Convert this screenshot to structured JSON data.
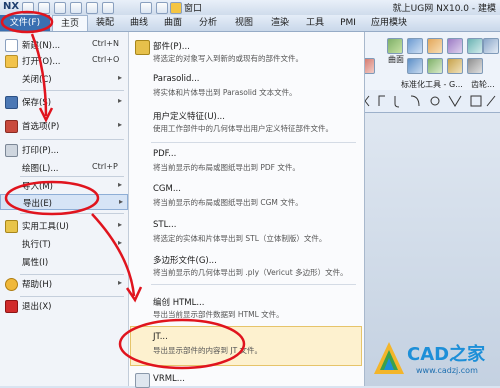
{
  "titlebar": {
    "logo": "NX",
    "window_menu": "窗口",
    "title": "就上UG网 NX10.0 - 建模"
  },
  "menubar": {
    "tabs": [
      "文件(F)",
      "主页",
      "装配",
      "曲线",
      "曲面",
      "分析",
      "视图",
      "渲染",
      "工具",
      "PMI",
      "应用模块"
    ]
  },
  "ribbon": {
    "surface_label": "曲面",
    "std_label": "标准化工具 - G...",
    "gear_label": "齿轮..."
  },
  "file_menu": {
    "items": [
      {
        "label": "新建(N)...",
        "shortcut": "Ctrl+N",
        "icon": "new-file-icon"
      },
      {
        "label": "打开(O)...",
        "shortcut": "Ctrl+O",
        "icon": "open-folder-icon"
      },
      {
        "label": "关闭(C)",
        "shortcut": "",
        "icon": "none"
      },
      {
        "label": "保存(S)",
        "shortcut": "",
        "icon": "save-icon"
      },
      {
        "label": "首选项(P)",
        "shortcut": "",
        "icon": "preferences-icon"
      },
      {
        "label": "打印(P)...",
        "shortcut": "",
        "icon": "printer-icon"
      },
      {
        "label": "绘图(L)...",
        "shortcut": "Ctrl+P",
        "icon": "none"
      },
      {
        "label": "导入(M)",
        "shortcut": "",
        "icon": "none"
      },
      {
        "label": "导出(E)",
        "shortcut": "",
        "icon": "none"
      },
      {
        "label": "实用工具(U)",
        "shortcut": "",
        "icon": "utilities-icon"
      },
      {
        "label": "执行(T)",
        "shortcut": "",
        "icon": "none"
      },
      {
        "label": "属性(I)",
        "shortcut": "",
        "icon": "none"
      },
      {
        "label": "帮助(H)",
        "shortcut": "",
        "icon": "help-icon"
      },
      {
        "label": "退出(X)",
        "shortcut": "",
        "icon": "exit-icon"
      }
    ]
  },
  "export_menu": {
    "items": [
      {
        "title": "部件(P)...",
        "desc1": "将选定的对象写入到新的或现有的部件文件。",
        "desc2": ""
      },
      {
        "title": "Parasolid...",
        "desc1": "将实体和片体导出到 Parasolid 文本文件。",
        "desc2": ""
      },
      {
        "title": "用户定义特征(U)...",
        "desc1": "使用工作部件中的几何体导出用户定义特征部件文件。",
        "desc2": ""
      },
      {
        "title": "PDF...",
        "desc1": "将当前显示的布局或图纸导出到 PDF 文件。",
        "desc2": ""
      },
      {
        "title": "CGM...",
        "desc1": "将当前显示的布局或图纸导出到 CGM 文件。",
        "desc2": ""
      },
      {
        "title": "STL...",
        "desc1": "将选定的实体和片体导出到 STL（立体制版）文件。",
        "desc2": ""
      },
      {
        "title": "多边形文件(G)...",
        "desc1": "将当前显示的几何体导出到 .ply（Vericut 多边形）文件。",
        "desc2": ""
      },
      {
        "title": "编创 HTML...",
        "desc1": "导出当前显示部件数据到 HTML 文件。",
        "desc2": ""
      },
      {
        "title": "JT...",
        "desc1": "导出显示部件的内容到 JT 文件。",
        "desc2": ""
      },
      {
        "title": "VRML...",
        "desc1": "",
        "desc2": ""
      }
    ]
  },
  "watermark": {
    "logo": "CAD之家",
    "url": "www.cadzj.com"
  },
  "colors": {
    "annotation_red": "#e0141e",
    "file_tab": "#3a6fb1",
    "highlight": "#fdf1cf"
  }
}
